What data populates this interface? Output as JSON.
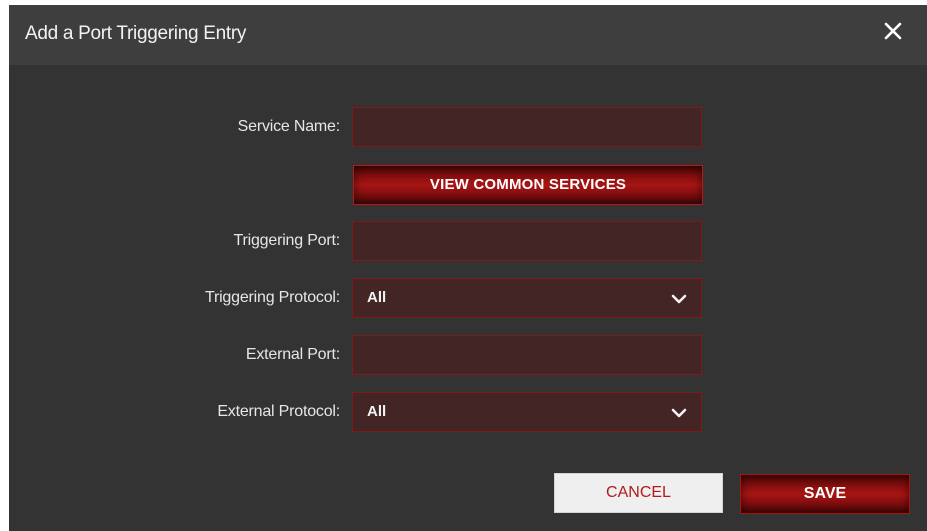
{
  "dialog": {
    "title": "Add a Port Triggering Entry",
    "close_icon": "close-icon"
  },
  "form": {
    "service_name": {
      "label": "Service Name:",
      "value": ""
    },
    "view_common_services_label": "VIEW COMMON SERVICES",
    "triggering_port": {
      "label": "Triggering Port:",
      "value": ""
    },
    "triggering_protocol": {
      "label": "Triggering Protocol:",
      "selected": "All",
      "icon": "chevron-down-icon"
    },
    "external_port": {
      "label": "External Port:",
      "value": ""
    },
    "external_protocol": {
      "label": "External Protocol:",
      "selected": "All",
      "icon": "chevron-down-icon"
    }
  },
  "actions": {
    "cancel_label": "CANCEL",
    "save_label": "SAVE"
  },
  "colors": {
    "background": "#333333",
    "titlebar": "#3e3e3e",
    "field_bg": "#432525",
    "field_border": "#7d1a1a",
    "accent": "#a81515",
    "cancel_text": "#b01c1c"
  }
}
